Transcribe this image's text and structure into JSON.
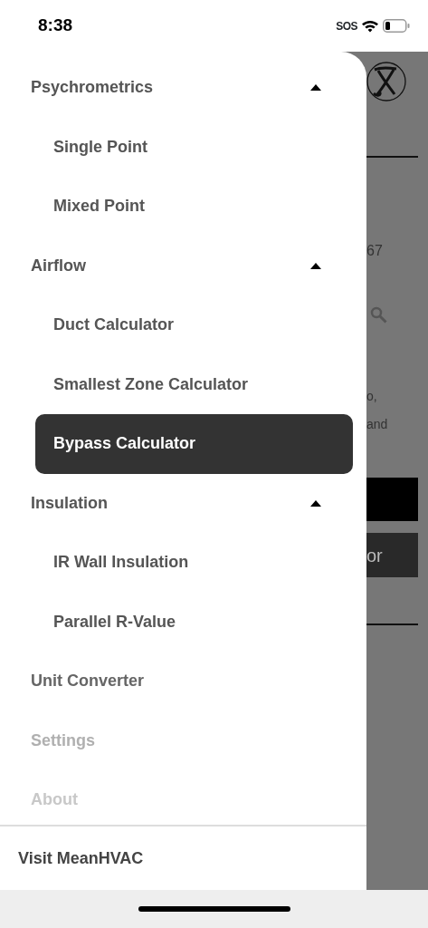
{
  "status_bar": {
    "time": "8:38",
    "carrier": "SOS"
  },
  "drawer": {
    "items": [
      {
        "kind": "group",
        "label": "Psychrometrics",
        "expanded": true,
        "children": [
          {
            "label": "Single Point",
            "selected": false
          },
          {
            "label": "Mixed Point",
            "selected": false
          }
        ]
      },
      {
        "kind": "group",
        "label": "Airflow",
        "expanded": true,
        "children": [
          {
            "label": "Duct Calculator",
            "selected": false
          },
          {
            "label": "Smallest Zone Calculator",
            "selected": false
          },
          {
            "label": "Bypass Calculator",
            "selected": true
          }
        ]
      },
      {
        "kind": "group",
        "label": "Insulation",
        "expanded": true,
        "children": [
          {
            "label": "IR Wall Insulation",
            "selected": false
          },
          {
            "label": "Parallel R-Value",
            "selected": false
          }
        ]
      },
      {
        "kind": "link",
        "label": "Unit Converter",
        "selected": false
      },
      {
        "kind": "link",
        "label": "Settings",
        "selected": false
      },
      {
        "kind": "link",
        "label": "About",
        "selected": false
      }
    ],
    "footer_link": "Visit MeanHVAC"
  },
  "background_page": {
    "fragments": [
      "67",
      "o,",
      "and",
      "or"
    ]
  }
}
